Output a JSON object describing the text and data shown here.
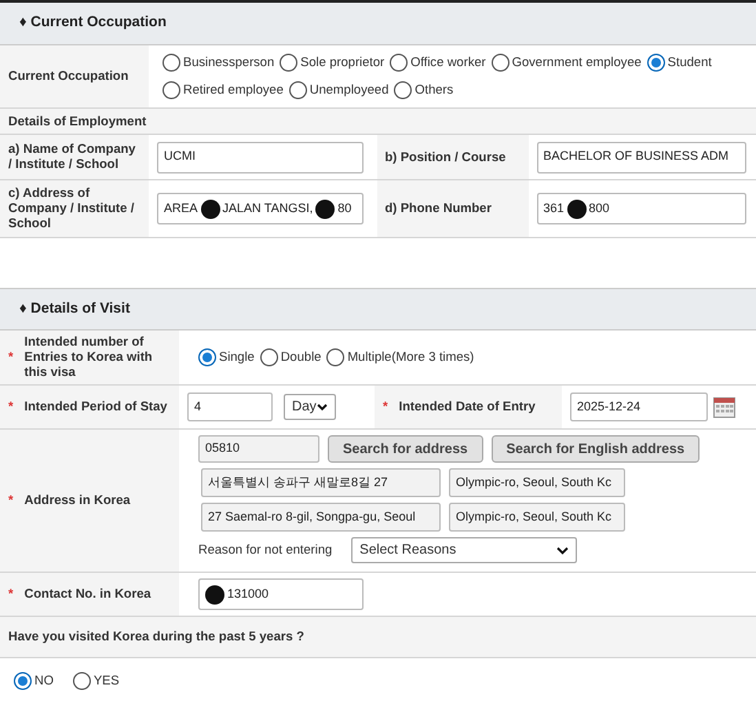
{
  "occupation_section": {
    "title": "♦ Current Occupation",
    "occupation": {
      "label": "Current Occupation",
      "options": [
        {
          "label": "Businessperson",
          "selected": false
        },
        {
          "label": "Sole proprietor",
          "selected": false
        },
        {
          "label": "Office worker",
          "selected": false
        },
        {
          "label": "Government employee",
          "selected": false
        },
        {
          "label": "Student",
          "selected": true
        },
        {
          "label": "Retired employee",
          "selected": false
        },
        {
          "label": "Unemployeed",
          "selected": false
        },
        {
          "label": "Others",
          "selected": false
        }
      ]
    },
    "employment_heading": "Details of Employment",
    "fields": [
      {
        "label": "a) Name of Company / Institute / School",
        "segments": [
          "UCMI"
        ]
      },
      {
        "label": "b) Position / Course",
        "segments": [
          "BACHELOR OF BUSINESS ADM"
        ]
      },
      {
        "label": "c) Address of Company / Institute / School",
        "segments": [
          "AREA",
          "JALAN TANGSI,",
          "80"
        ]
      },
      {
        "label": "d) Phone Number",
        "segments": [
          "361",
          "800"
        ]
      }
    ]
  },
  "visit_section": {
    "title": "♦ Details of Visit",
    "entries": {
      "mark": "*",
      "label": "Intended number of Entries to Korea with this visa",
      "options": [
        {
          "label": "Single",
          "selected": true
        },
        {
          "label": "Double",
          "selected": false
        },
        {
          "label": "Multiple(More 3 times)",
          "selected": false
        }
      ]
    },
    "stay": {
      "mark": "*",
      "label": "Intended Period of Stay",
      "value": "4",
      "unit": "Day"
    },
    "entry_date": {
      "mark": "*",
      "label": "Intended Date of Entry",
      "value": "2025-12-24"
    },
    "address": {
      "mark": "*",
      "label": "Address in Korea",
      "postcode": "05810",
      "buttons": [
        "Search for address",
        "Search for English address"
      ],
      "lines": [
        [
          "서울특별시 송파구 새말로8길 27",
          "Olympic-ro, Seoul, South Kc"
        ],
        [
          "27 Saemal-ro 8-gil, Songpa-gu, Seoul",
          "Olympic-ro, Seoul, South Kc"
        ]
      ],
      "reason_label": "Reason for not entering",
      "reason_select": "Select Reasons"
    },
    "contact": {
      "mark": "*",
      "label": "Contact No. in Korea",
      "leading_redaction": true,
      "segments": [
        "131000"
      ]
    },
    "visited": {
      "question": "Have you visited Korea during the past 5 years ?",
      "options": [
        {
          "label": "NO",
          "selected": true
        },
        {
          "label": "YES",
          "selected": false
        }
      ]
    }
  }
}
